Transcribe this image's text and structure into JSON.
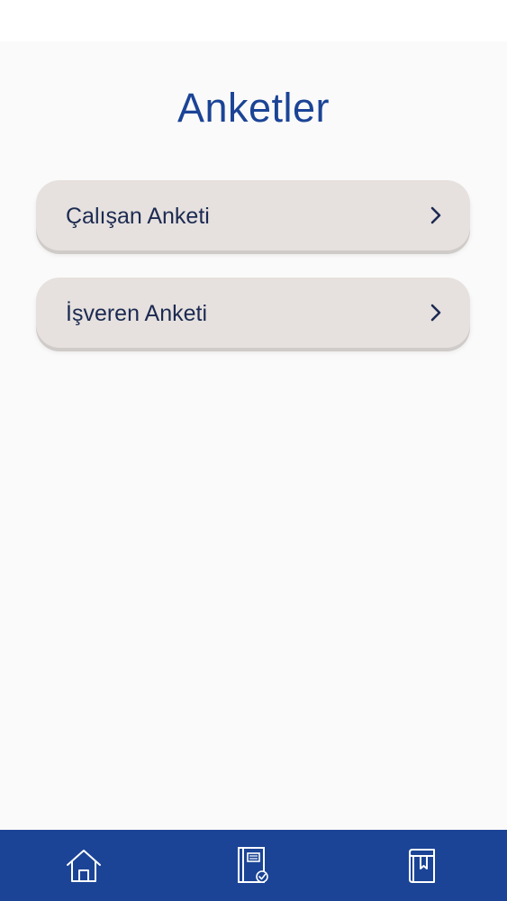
{
  "page": {
    "title": "Anketler"
  },
  "menu": {
    "items": [
      {
        "label": "Çalışan Anketi",
        "icon": "chevron-right-icon"
      },
      {
        "label": "İşveren Anketi",
        "icon": "chevron-right-icon"
      }
    ]
  },
  "tab_bar": {
    "tabs": [
      {
        "icon": "home-icon"
      },
      {
        "icon": "survey-document-icon"
      },
      {
        "icon": "book-icon"
      }
    ]
  },
  "colors": {
    "accent": "#1b4496",
    "card": "#e6e1de",
    "text": "#1c2a52",
    "background": "#fbfafa"
  }
}
